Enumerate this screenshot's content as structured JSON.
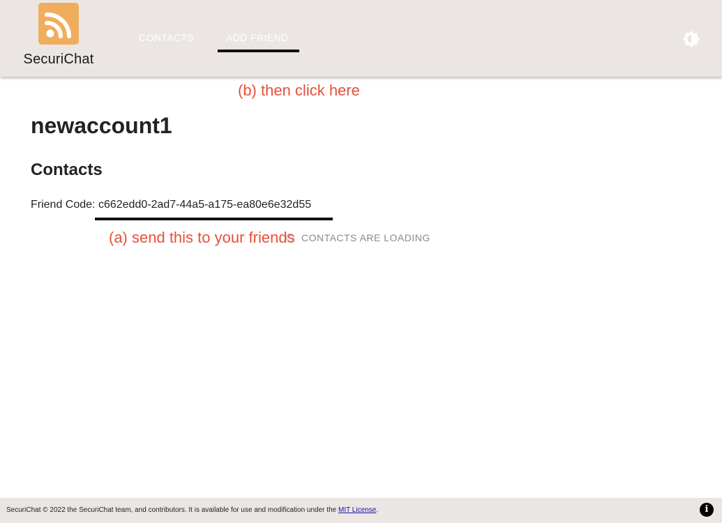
{
  "app": {
    "name": "SecuriChat",
    "logo_icon": "rss-feed-icon",
    "brand_color": "#f0ad5e"
  },
  "header": {
    "background": "#ebe6e4",
    "tabs": [
      {
        "label": "CONTACTS",
        "active": false
      },
      {
        "label": "ADD FRIEND",
        "active": true
      }
    ],
    "theme_toggle_icon": "brightness-icon"
  },
  "annotations": {
    "color": "#e8503a",
    "click_here": "(b) then click here",
    "send_this": "(a) send this to your friends"
  },
  "main": {
    "account_name": "newaccount1",
    "section_title": "Contacts",
    "friend_code_label": "Friend Code:",
    "friend_code": "c662edd0-2ad7-44a5-a175-ea80e6e32d55",
    "loading_text": "CONTACTS ARE LOADING",
    "loading_icon": "spinner-icon"
  },
  "footer": {
    "text_before_link": "SecuriChat © 2022 the SecuriChat team, and contributors. It is available for use and modification under the",
    "link_text": "MIT License",
    "text_after_link": ".",
    "info_icon": "info-icon"
  }
}
